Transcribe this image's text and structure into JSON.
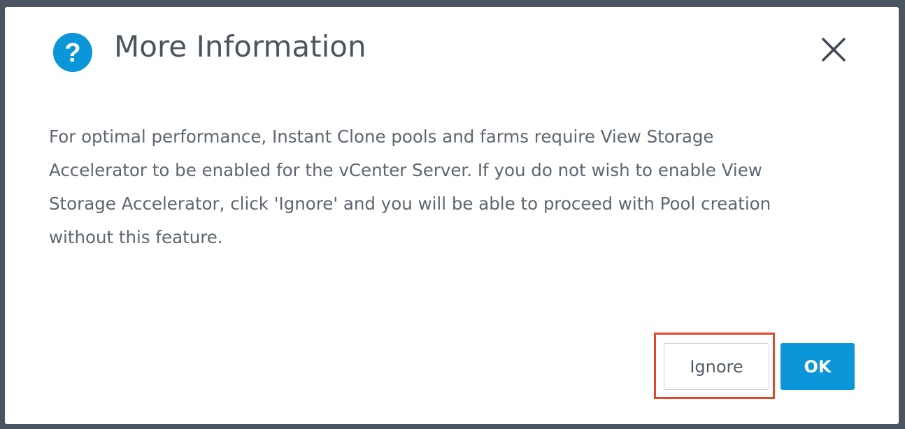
{
  "dialog": {
    "title": "More Information",
    "icon": "question-circle-icon",
    "close_icon": "close-icon",
    "message": "For optimal performance, Instant Clone pools and farms require View Storage\nAccelerator to be enabled for the vCenter Server. If you do not wish to enable View\nStorage Accelerator, click 'Ignore' and you will be able to proceed with Pool creation\nwithout this feature.",
    "buttons": {
      "ignore_label": "Ignore",
      "ok_label": "OK"
    }
  },
  "colors": {
    "background": "#4a5561",
    "dialog": "#ffffff",
    "icon_blue": "#0a96d8",
    "ok_button": "#0a96d8",
    "highlight": "#e2472e",
    "title_text": "#4a5560",
    "body_text": "#5d6670"
  }
}
